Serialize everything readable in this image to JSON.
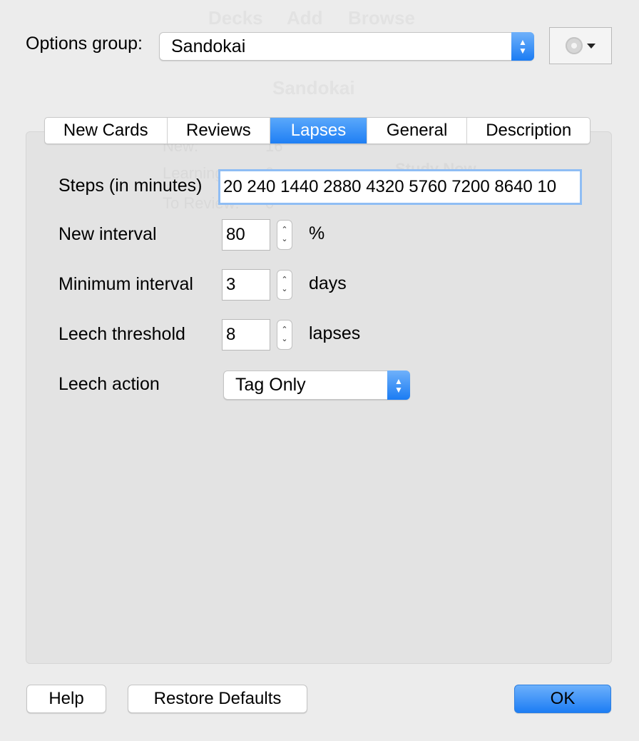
{
  "background": {
    "ghost_nav": [
      "Decks",
      "Add",
      "Browse"
    ],
    "ghost_deck_title": "Sandokai",
    "ghost_stats": [
      {
        "label": "New:",
        "value": "16"
      },
      {
        "label": "Learning:",
        "value": "0"
      },
      {
        "label": "To Review:",
        "value": "0"
      }
    ],
    "ghost_study_button": "Study Now"
  },
  "options_group": {
    "label": "Options group:",
    "selected": "Sandokai",
    "gear_icon": "gear-icon"
  },
  "tabs": [
    {
      "label": "New Cards",
      "active": false
    },
    {
      "label": "Reviews",
      "active": false
    },
    {
      "label": "Lapses",
      "active": true
    },
    {
      "label": "General",
      "active": false
    },
    {
      "label": "Description",
      "active": false
    }
  ],
  "fields": {
    "steps": {
      "label": "Steps (in minutes)",
      "value": "20 240 1440 2880 4320 5760 7200 8640 10"
    },
    "new_interval": {
      "label": "New interval",
      "value": "80",
      "unit": "%"
    },
    "minimum_interval": {
      "label": "Minimum interval",
      "value": "3",
      "unit": "days"
    },
    "leech_threshold": {
      "label": "Leech threshold",
      "value": "8",
      "unit": "lapses"
    },
    "leech_action": {
      "label": "Leech action",
      "selected": "Tag Only"
    }
  },
  "buttons": {
    "help": "Help",
    "restore_defaults": "Restore Defaults",
    "ok": "OK"
  },
  "colors": {
    "accent": "#1f7ff4",
    "window_bg": "#ececec",
    "panel_bg": "#e3e3e3"
  }
}
